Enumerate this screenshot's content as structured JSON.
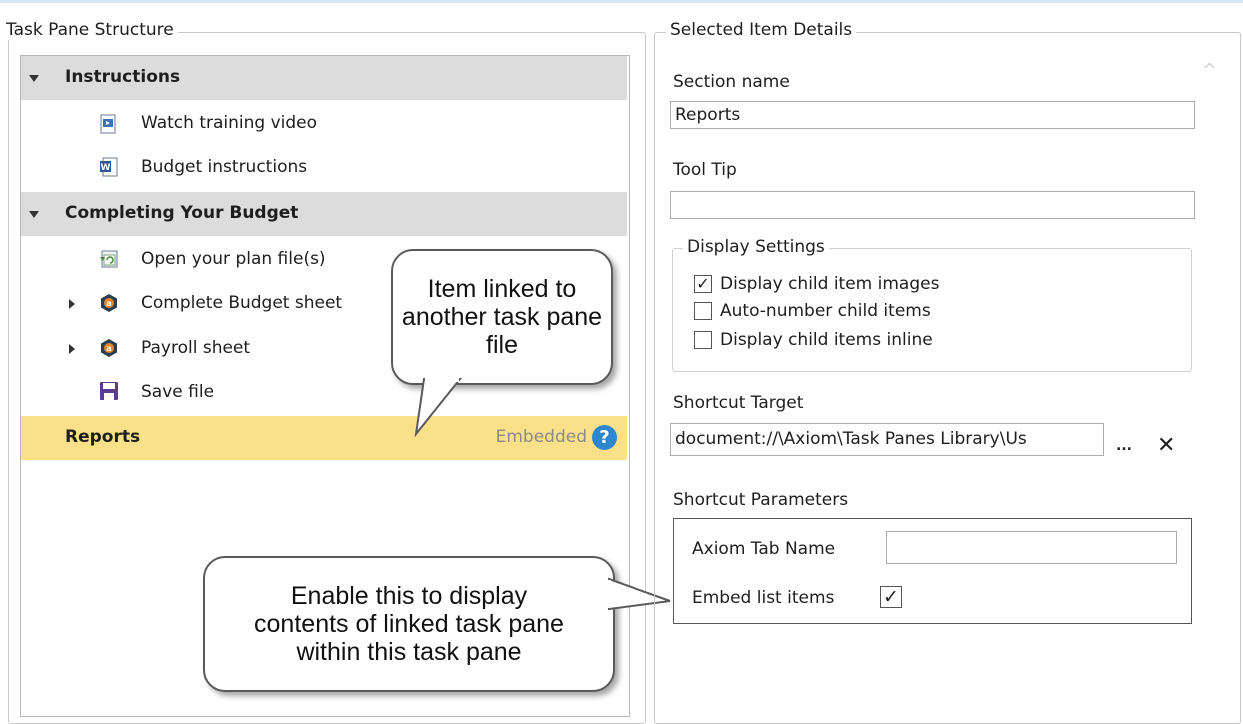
{
  "left_panel": {
    "title": "Task Pane Structure",
    "rows": [
      {
        "type": "section",
        "label": "Instructions"
      },
      {
        "type": "item",
        "label": "Watch training video",
        "icon": "video-doc-icon"
      },
      {
        "type": "item",
        "label": "Budget instructions",
        "icon": "word-doc-icon"
      },
      {
        "type": "section",
        "label": "Completing Your Budget"
      },
      {
        "type": "item",
        "label": "Open your plan file(s)",
        "icon": "refresh-doc-icon"
      },
      {
        "type": "item",
        "label": "Complete Budget sheet",
        "icon": "axiom-icon"
      },
      {
        "type": "item",
        "label": "Payroll sheet",
        "icon": "axiom-icon"
      },
      {
        "type": "item",
        "label": "Save file",
        "icon": "save-icon"
      },
      {
        "type": "selected",
        "label": "Reports",
        "badge": "Embedded"
      }
    ]
  },
  "callouts": {
    "top": "Item linked to another task pane file",
    "bottom": "Enable this to display contents of linked task pane within this task pane"
  },
  "right_panel": {
    "title": "Selected Item Details",
    "section_name_label": "Section name",
    "section_name_value": "Reports",
    "tooltip_label": "Tool Tip",
    "tooltip_value": "",
    "display_settings": {
      "title": "Display Settings",
      "options": [
        {
          "label": "Display child item images",
          "checked": true
        },
        {
          "label": "Auto-number child items",
          "checked": false
        },
        {
          "label": "Display child items inline",
          "checked": false
        }
      ]
    },
    "shortcut_target_label": "Shortcut Target",
    "shortcut_target_value": "document://\\Axiom\\Task Panes Library\\Us",
    "browse_label": "...",
    "clear_label": "✕",
    "shortcut_parameters_label": "Shortcut Parameters",
    "axiom_tab_name_label": "Axiom Tab Name",
    "axiom_tab_name_value": "",
    "embed_list_items_label": "Embed list items",
    "embed_list_items_checked": true
  },
  "colors": {
    "section_bg": "#dcdcdc",
    "selected_bg": "#fbe08a",
    "help_blue": "#2e86cf"
  }
}
